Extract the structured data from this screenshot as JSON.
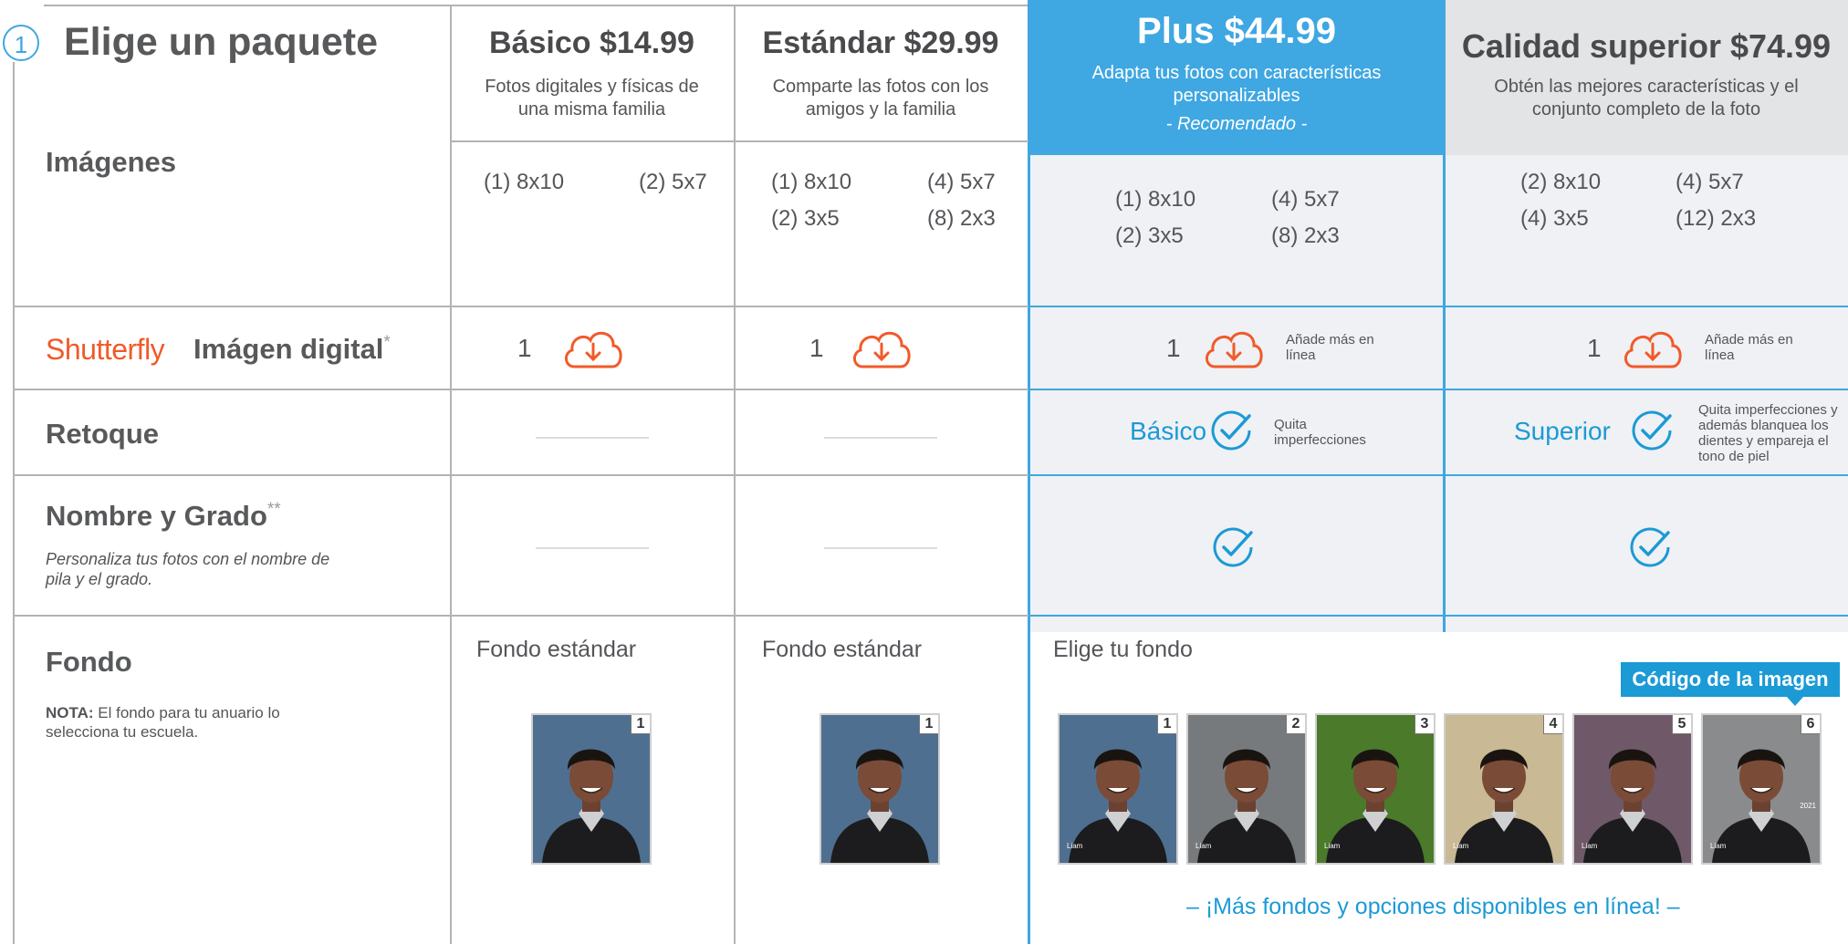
{
  "step_number": "1",
  "title": "Elige un paquete",
  "rows": {
    "images": "Imágenes",
    "digital_brand": "Shutterfly",
    "digital": "Imágen digital",
    "digital_mark": "*",
    "retouch": "Retoque",
    "name_grade": "Nombre y Grado",
    "name_grade_mark": "**",
    "name_grade_desc": "Personaliza tus fotos con el nombre de pila y el grado.",
    "background": "Fondo",
    "background_note_bold": "NOTA:",
    "background_note": " El fondo para tu anuario lo selecciona tu escuela."
  },
  "packages": [
    {
      "name": "Básico $14.99",
      "desc": "Fotos digitales y físicas de una misma familia",
      "prints": [
        "(1) 8x10",
        "(2) 5x7"
      ],
      "digital_count": "1",
      "background": "Fondo estándar"
    },
    {
      "name": "Estándar $29.99",
      "desc": "Comparte las fotos con los amigos y la familia",
      "prints": [
        "(1) 8x10",
        "(4) 5x7",
        "(2) 3x5",
        "(8) 2x3"
      ],
      "digital_count": "1",
      "background": "Fondo estándar"
    },
    {
      "name": "Plus $44.99",
      "desc": "Adapta tus fotos con características personalizables",
      "recommended": "- Recomendado -",
      "prints": [
        "(1) 8x10",
        "(4) 5x7",
        "(2) 3x5",
        "(8) 2x3"
      ],
      "digital_count": "1",
      "digital_note": "Añade más en línea",
      "retouch_level": "Básico",
      "retouch_note": "Quita imperfecciones",
      "background": "Elige tu fondo"
    },
    {
      "name": "Calidad superior $74.99",
      "desc": "Obtén las mejores características y el conjunto completo de la foto",
      "prints": [
        "(2) 8x10",
        "(4) 5x7",
        "(4) 3x5",
        "(12) 2x3"
      ],
      "digital_count": "1",
      "digital_note": "Añade más en línea",
      "retouch_level": "Superior",
      "retouch_note": "Quita imperfecciones y además blanquea los dientes y empareja el tono de piel"
    }
  ],
  "background_options": [
    "1",
    "2",
    "3",
    "4",
    "5",
    "6"
  ],
  "background_colors": [
    "#4f6f90",
    "#777a7d",
    "#4a7a2a",
    "#c9b994",
    "#6f5868",
    "#8a8b8d"
  ],
  "overlay_name": "Liam",
  "overlay_year": "2021",
  "image_code_label": "Código de la imagen",
  "more_online": "– ¡Más fondos y opciones disponibles en línea! –",
  "colors": {
    "accent_blue": "#3fa7e1",
    "link_blue": "#1b9ad6",
    "cloud_orange": "#f15a29"
  }
}
